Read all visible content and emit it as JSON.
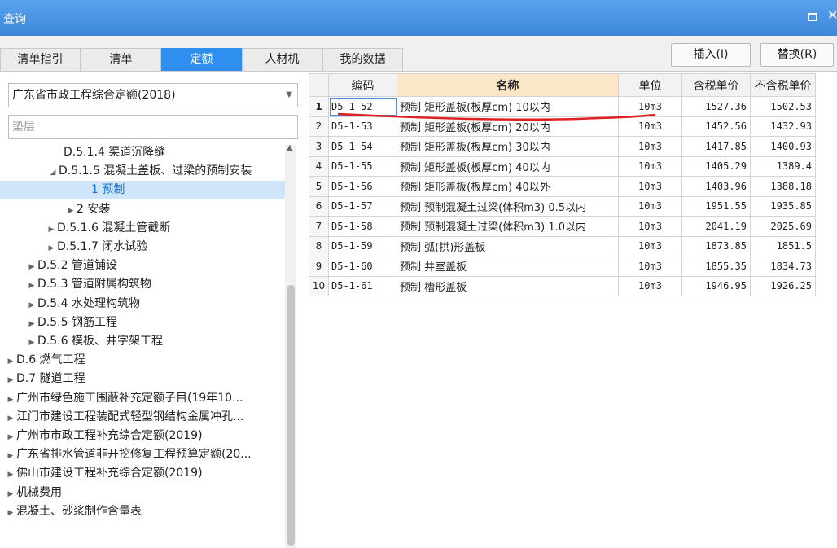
{
  "window": {
    "title": "查询"
  },
  "tabs": [
    {
      "label": "清单指引"
    },
    {
      "label": "清单"
    },
    {
      "label": "定额"
    },
    {
      "label": "人材机"
    },
    {
      "label": "我的数据"
    }
  ],
  "toolbar": {
    "insert_label": "插入(I)",
    "replace_label": "替换(R)"
  },
  "library": {
    "selected": "广东省市政工程综合定额(2018)"
  },
  "search": {
    "value": "垫层"
  },
  "tree": [
    {
      "label": "D.5.1.4 渠道沉降缝",
      "toggle": ""
    },
    {
      "label": "D.5.1.5 混凝土盖板、过梁的预制安装",
      "toggle": "◢"
    },
    {
      "label": "1 预制",
      "toggle": ""
    },
    {
      "label": "2 安装",
      "toggle": "▶"
    },
    {
      "label": "D.5.1.6 混凝土管截断",
      "toggle": "▶"
    },
    {
      "label": "D.5.1.7 闭水试验",
      "toggle": "▶"
    },
    {
      "label": "D.5.2 管道铺设",
      "toggle": "▶"
    },
    {
      "label": "D.5.3 管道附属构筑物",
      "toggle": "▶"
    },
    {
      "label": "D.5.4 水处理构筑物",
      "toggle": "▶"
    },
    {
      "label": "D.5.5 钢筋工程",
      "toggle": "▶"
    },
    {
      "label": "D.5.6 模板、井字架工程",
      "toggle": "▶"
    },
    {
      "label": "D.6 燃气工程",
      "toggle": "▶"
    },
    {
      "label": "D.7 隧道工程",
      "toggle": "▶"
    },
    {
      "label": "广州市绿色施工围蔽补充定额子目(19年10...",
      "toggle": "▶"
    },
    {
      "label": "江门市建设工程装配式轻型钢结构金属冲孔...",
      "toggle": "▶"
    },
    {
      "label": "广州市市政工程补充综合定额(2019)",
      "toggle": "▶"
    },
    {
      "label": "广东省排水管道非开挖修复工程预算定额(20...",
      "toggle": "▶"
    },
    {
      "label": "佛山市建设工程补充综合定额(2019)",
      "toggle": "▶"
    },
    {
      "label": "机械费用",
      "toggle": "▶"
    },
    {
      "label": "混凝土、砂浆制作含量表",
      "toggle": "▶"
    }
  ],
  "grid": {
    "columns": [
      "编码",
      "名称",
      "单位",
      "含税单价",
      "不含税单价"
    ],
    "rows": [
      {
        "n": "1",
        "code": "D5-1-52",
        "name": "预制 矩形盖板(板厚cm) 10以内",
        "unit": "10m3",
        "tax": "1527.36",
        "notax": "1502.53"
      },
      {
        "n": "2",
        "code": "D5-1-53",
        "name": "预制 矩形盖板(板厚cm) 20以内",
        "unit": "10m3",
        "tax": "1452.56",
        "notax": "1432.93"
      },
      {
        "n": "3",
        "code": "D5-1-54",
        "name": "预制 矩形盖板(板厚cm) 30以内",
        "unit": "10m3",
        "tax": "1417.85",
        "notax": "1400.93"
      },
      {
        "n": "4",
        "code": "D5-1-55",
        "name": "预制 矩形盖板(板厚cm) 40以内",
        "unit": "10m3",
        "tax": "1405.29",
        "notax": "1389.4"
      },
      {
        "n": "5",
        "code": "D5-1-56",
        "name": "预制 矩形盖板(板厚cm) 40以外",
        "unit": "10m3",
        "tax": "1403.96",
        "notax": "1388.18"
      },
      {
        "n": "6",
        "code": "D5-1-57",
        "name": "预制 预制混凝土过梁(体积m3) 0.5以内",
        "unit": "10m3",
        "tax": "1951.55",
        "notax": "1935.85"
      },
      {
        "n": "7",
        "code": "D5-1-58",
        "name": "预制 预制混凝土过梁(体积m3) 1.0以内",
        "unit": "10m3",
        "tax": "2041.19",
        "notax": "2025.69"
      },
      {
        "n": "8",
        "code": "D5-1-59",
        "name": "预制 弧(拱)形盖板",
        "unit": "10m3",
        "tax": "1873.85",
        "notax": "1851.5"
      },
      {
        "n": "9",
        "code": "D5-1-60",
        "name": "预制 井室盖板",
        "unit": "10m3",
        "tax": "1855.35",
        "notax": "1834.73"
      },
      {
        "n": "10",
        "code": "D5-1-61",
        "name": "预制 槽形盖板",
        "unit": "10m3",
        "tax": "1946.95",
        "notax": "1926.25"
      }
    ]
  },
  "colors": {
    "accent": "#2f8ff0",
    "annotation": "#e02020"
  }
}
